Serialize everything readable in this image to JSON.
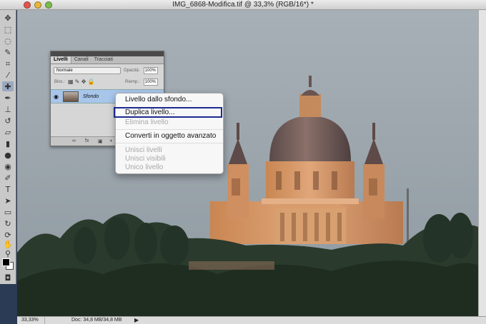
{
  "window": {
    "title": "IMG_6868-Modifica.tif @ 33,3% (RGB/16*) *"
  },
  "toolbox": {
    "tools": [
      "move-icon",
      "marquee-icon",
      "lasso-icon",
      "quick-select-icon",
      "crop-icon",
      "eyedropper-icon",
      "healing-brush-icon",
      "brush-icon",
      "clone-stamp-icon",
      "history-brush-icon",
      "eraser-icon",
      "gradient-icon",
      "blur-icon",
      "dodge-icon",
      "pen-icon",
      "type-icon",
      "path-select-icon",
      "shape-icon",
      "3d-rotate-icon",
      "3d-orbit-icon",
      "hand-icon",
      "zoom-icon"
    ]
  },
  "layers_panel": {
    "tabs": [
      "Livelli",
      "Canali",
      "Tracciati"
    ],
    "blend_mode": "Normale",
    "opacity_label": "Opacità:",
    "opacity_value": "100%",
    "lock_label": "Bloc.:",
    "fill_label": "Riemp.:",
    "fill_value": "100%",
    "layer_name": "Sfondo"
  },
  "context_menu": {
    "items": [
      "Livello dallo sfondo...",
      "Duplica livello...",
      "Elimina livello",
      "Converti in oggetto avanzato",
      "Unisci livelli",
      "Unisci visibili",
      "Unico livello"
    ],
    "highlighted": "Duplica livello...",
    "disabled": [
      "Elimina livello",
      "Unisci livelli",
      "Unisci visibili",
      "Unico livello"
    ]
  },
  "statusbar": {
    "zoom": "33,33%",
    "doc_info": "Doc: 34,8 MB/34,8 MB"
  },
  "colors": {
    "sky": "#9ba4ab",
    "basilica": "#c98a5a",
    "trees": "#233126",
    "menu_highlight": "#1c2a8f"
  }
}
